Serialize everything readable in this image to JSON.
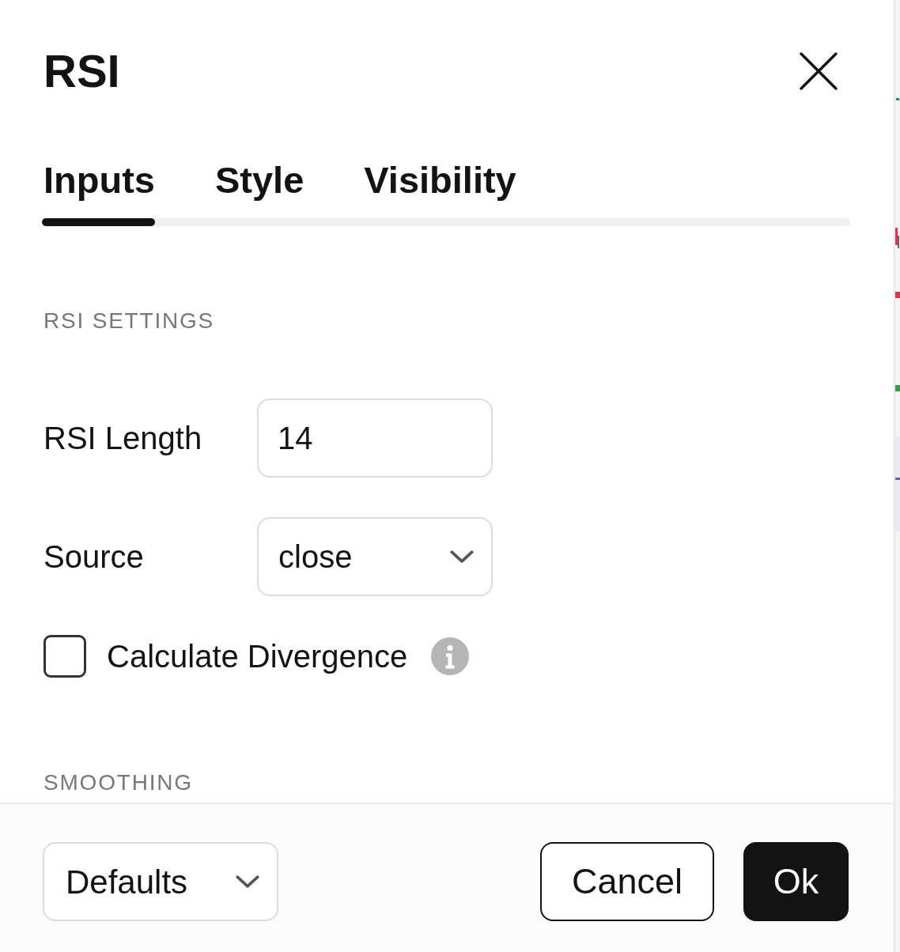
{
  "dialog": {
    "title": "RSI"
  },
  "tabs": [
    {
      "label": "Inputs",
      "selected": true
    },
    {
      "label": "Style",
      "selected": false
    },
    {
      "label": "Visibility",
      "selected": false
    }
  ],
  "sections": [
    {
      "heading": "RSI SETTINGS",
      "fields": [
        {
          "kind": "number",
          "label": "RSI Length",
          "value": "14"
        },
        {
          "kind": "select",
          "label": "Source",
          "value": "close"
        },
        {
          "kind": "checkbox",
          "label": "Calculate Divergence",
          "checked": false
        }
      ]
    },
    {
      "heading": "SMOOTHING"
    }
  ],
  "footer": {
    "preset": {
      "value": "Defaults"
    },
    "buttons": [
      {
        "kind": "secondary",
        "label": "Cancel"
      },
      {
        "kind": "primary",
        "label": "Ok"
      }
    ]
  }
}
